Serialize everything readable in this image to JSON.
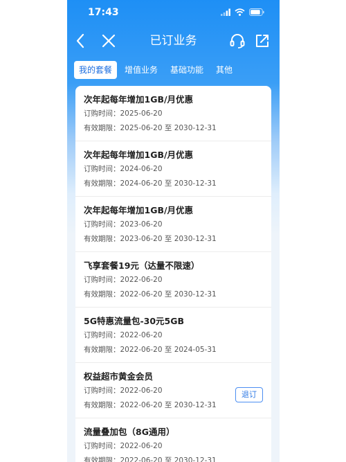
{
  "status": {
    "time": "17:43"
  },
  "nav": {
    "title": "已订业务"
  },
  "tabs": [
    {
      "label": "我的套餐",
      "active": true
    },
    {
      "label": "增值业务",
      "active": false
    },
    {
      "label": "基础功能",
      "active": false
    },
    {
      "label": "其他",
      "active": false
    }
  ],
  "items": [
    {
      "title": "次年起每年增加1GB/月优惠",
      "order_label": "订购时间：",
      "order_date": "2025-06-20",
      "valid_label": "有效期限：",
      "valid_range": "2025-06-20 至 2030-12-31"
    },
    {
      "title": "次年起每年增加1GB/月优惠",
      "order_label": "订购时间：",
      "order_date": "2024-06-20",
      "valid_label": "有效期限：",
      "valid_range": "2024-06-20 至 2030-12-31"
    },
    {
      "title": "次年起每年增加1GB/月优惠",
      "order_label": "订购时间：",
      "order_date": "2023-06-20",
      "valid_label": "有效期限：",
      "valid_range": "2023-06-20 至 2030-12-31"
    },
    {
      "title": "飞享套餐19元（达量不限速）",
      "order_label": "订购时间：",
      "order_date": "2022-06-20",
      "valid_label": "有效期限：",
      "valid_range": "2022-06-20 至 2030-12-31"
    },
    {
      "title": "5G特惠流量包-30元5GB",
      "order_label": "订购时间：",
      "order_date": "2022-06-20",
      "valid_label": "有效期限：",
      "valid_range": "2022-06-20 至 2024-05-31"
    },
    {
      "title": "权益超市黄金会员",
      "order_label": "订购时间：",
      "order_date": "2022-06-20",
      "valid_label": "有效期限：",
      "valid_range": "2022-06-20 至 2030-12-31",
      "button": "退订"
    },
    {
      "title": "流量叠加包（8G通用）",
      "order_label": "订购时间：",
      "order_date": "2022-06-20",
      "valid_label": "有效期限：",
      "valid_range": "2022-06-20 至 2030-12-31"
    }
  ],
  "colors": {
    "header_blue": "#1e8ff5",
    "link_blue": "#2f7ae5"
  }
}
